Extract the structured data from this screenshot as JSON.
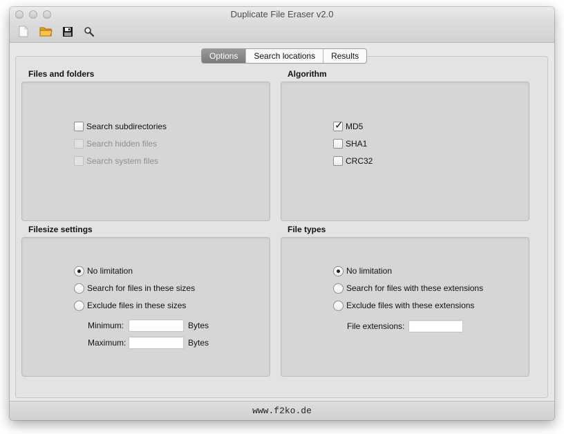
{
  "window": {
    "title": "Duplicate File Eraser v2.0"
  },
  "toolbar": {
    "items": [
      {
        "icon": "new-document-icon"
      },
      {
        "icon": "open-folder-icon"
      },
      {
        "icon": "save-disk-icon"
      },
      {
        "icon": "search-icon"
      }
    ]
  },
  "tabs": [
    {
      "label": "Options",
      "active": true
    },
    {
      "label": "Search locations",
      "active": false
    },
    {
      "label": "Results",
      "active": false
    }
  ],
  "files_and_folders": {
    "title": "Files and folders",
    "options": [
      {
        "label": "Search subdirectories",
        "checked": false,
        "enabled": true
      },
      {
        "label": "Search hidden files",
        "checked": false,
        "enabled": false
      },
      {
        "label": "Search system files",
        "checked": false,
        "enabled": false
      }
    ]
  },
  "algorithm": {
    "title": "Algorithm",
    "options": [
      {
        "label": "MD5",
        "checked": true
      },
      {
        "label": "SHA1",
        "checked": false
      },
      {
        "label": "CRC32",
        "checked": false
      }
    ]
  },
  "filesize": {
    "title": "Filesize settings",
    "options": [
      {
        "label": "No limitation",
        "selected": true
      },
      {
        "label": "Search for files in these sizes",
        "selected": false
      },
      {
        "label": "Exclude files in these sizes",
        "selected": false
      }
    ],
    "minimum_label": "Minimum:",
    "maximum_label": "Maximum:",
    "minimum_value": "",
    "maximum_value": "",
    "unit": "Bytes"
  },
  "file_types": {
    "title": "File types",
    "options": [
      {
        "label": "No limitation",
        "selected": true
      },
      {
        "label": "Search for files with these extensions",
        "selected": false
      },
      {
        "label": "Exclude files with these extensions",
        "selected": false
      }
    ],
    "extensions_label": "File extensions:",
    "extensions_value": ""
  },
  "status": {
    "text": "www.f2ko.de"
  }
}
